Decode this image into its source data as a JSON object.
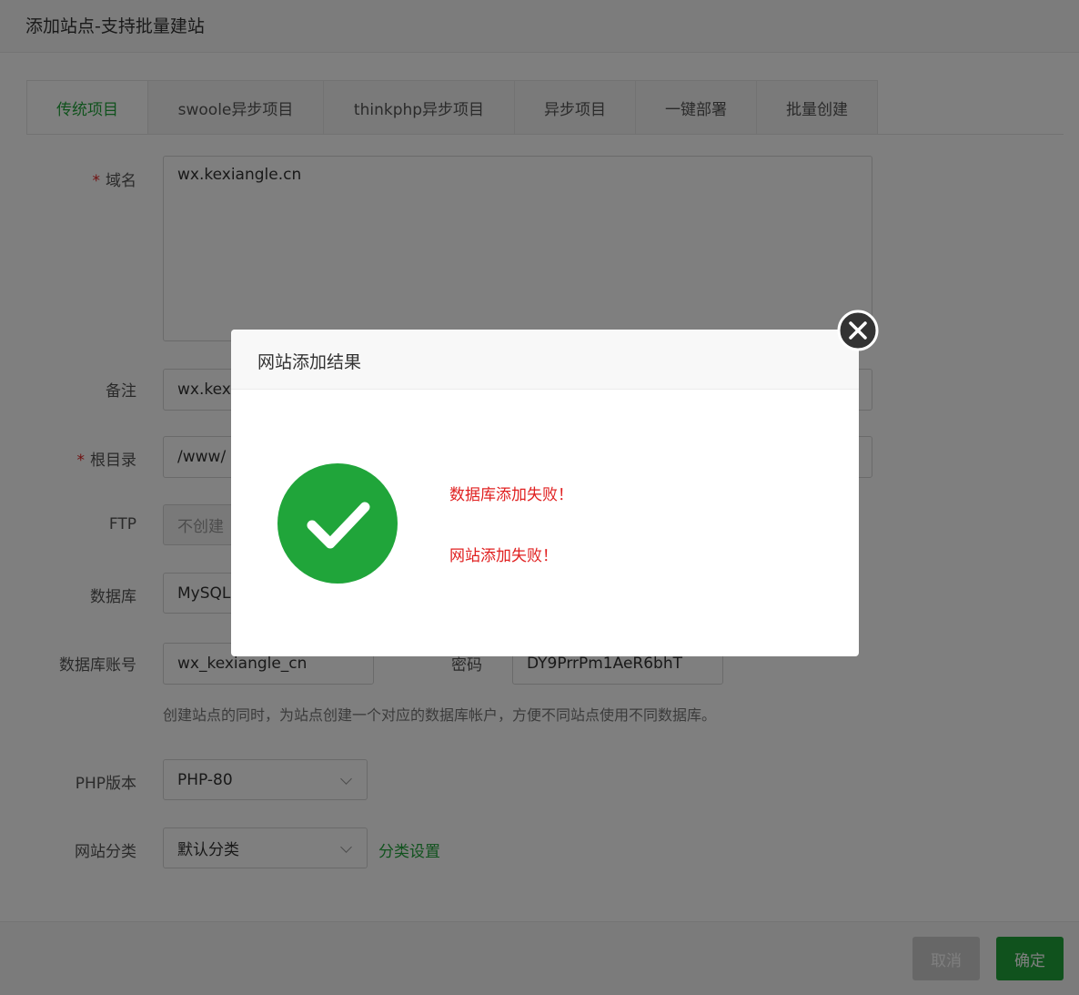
{
  "window": {
    "title": "添加站点-支持批量建站"
  },
  "tabs": [
    {
      "label": "传统项目"
    },
    {
      "label": "swoole异步项目"
    },
    {
      "label": "thinkphp异步项目"
    },
    {
      "label": "异步项目"
    },
    {
      "label": "一键部署"
    },
    {
      "label": "批量创建"
    }
  ],
  "form": {
    "domain": {
      "label": "域名",
      "required_mark": "*",
      "value": "wx.kexiangle.cn"
    },
    "remark": {
      "label": "备注",
      "value": "wx.kexi"
    },
    "root": {
      "label": "根目录",
      "required_mark": "*",
      "value": "/www/"
    },
    "ftp": {
      "label": "FTP",
      "value": "不创建"
    },
    "database": {
      "label": "数据库",
      "value": "MySQL"
    },
    "db_account": {
      "label": "数据库账号",
      "value": "wx_kexiangle_cn"
    },
    "password": {
      "label": "密码",
      "value": "DY9PrrPm1AeR6bhT"
    },
    "db_hint": "创建站点的同时，为站点创建一个对应的数据库帐户，方便不同站点使用不同数据库。",
    "php": {
      "label": "PHP版本",
      "value": "PHP-80"
    },
    "category": {
      "label": "网站分类",
      "value": "默认分类",
      "link": "分类设置"
    }
  },
  "footer": {
    "cancel_label": "取消",
    "ok_label": "确定"
  },
  "dialog": {
    "title": "网站添加结果",
    "messages": [
      "数据库添加失败！",
      "网站添加失败！"
    ],
    "icon": "check-circle-icon",
    "icon_color": "#20a53a"
  },
  "colors": {
    "accent": "#20a53a",
    "error": "#e02020"
  }
}
